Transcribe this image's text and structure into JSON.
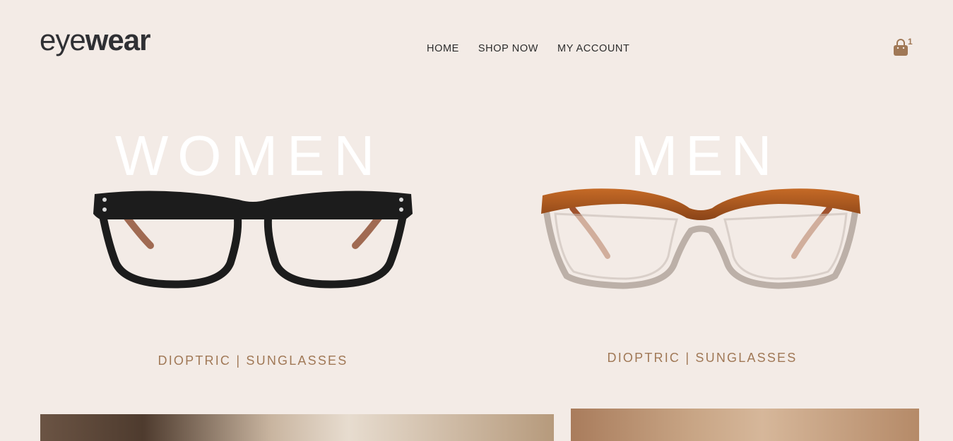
{
  "header": {
    "logo": {
      "light": "eye",
      "bold": "wear"
    },
    "nav": [
      {
        "label": "HOME"
      },
      {
        "label": "SHOP NOW"
      },
      {
        "label": "MY ACCOUNT"
      }
    ],
    "cart": {
      "icon": "shopping-bag-icon",
      "count": "1"
    }
  },
  "categories": [
    {
      "title": "WOMEN",
      "links": [
        "DIOPTRIC",
        "SUNGLASSES"
      ],
      "separator": "|"
    },
    {
      "title": "MEN",
      "links": [
        "DIOPTRIC",
        "SUNGLASSES"
      ],
      "separator": "|"
    }
  ],
  "colors": {
    "background": "#f3ebe6",
    "accent": "#a07856",
    "text": "#2c2c2c"
  }
}
